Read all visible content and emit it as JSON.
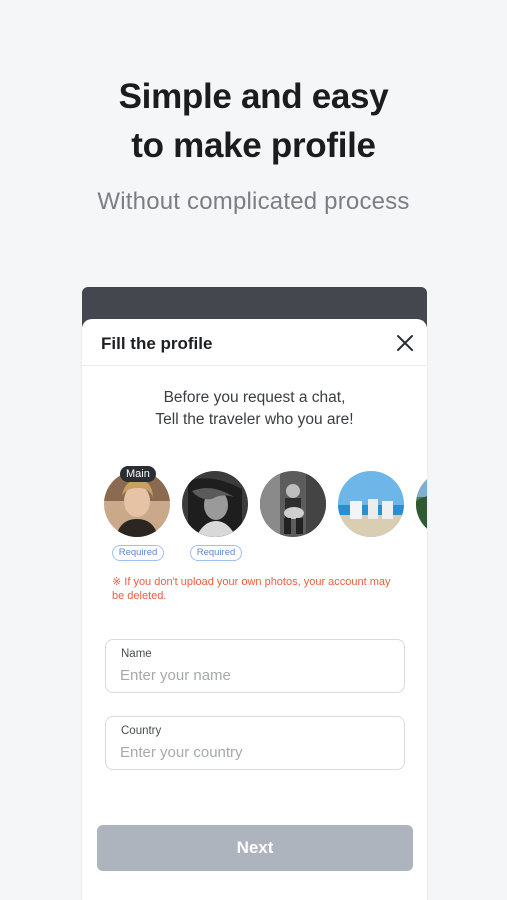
{
  "promo": {
    "headline_line1": "Simple and easy",
    "headline_line2": "to make profile",
    "subline": "Without complicated process"
  },
  "sheet": {
    "title": "Fill the profile",
    "intro_line1": "Before you request a chat,",
    "intro_line2": "Tell the traveler who you are!",
    "main_badge": "Main",
    "required_label": "Required",
    "warning": "※ If you don't upload your own photos, your account may be deleted.",
    "next_label": "Next"
  },
  "form": {
    "name_label": "Name",
    "name_placeholder": "Enter your name",
    "name_value": "",
    "country_label": "Country",
    "country_placeholder": "Enter your country",
    "country_value": ""
  },
  "colors": {
    "accent_warning": "#ee5d3c",
    "required_badge": "#5b86d6",
    "button_disabled": "#aeb4bd"
  }
}
